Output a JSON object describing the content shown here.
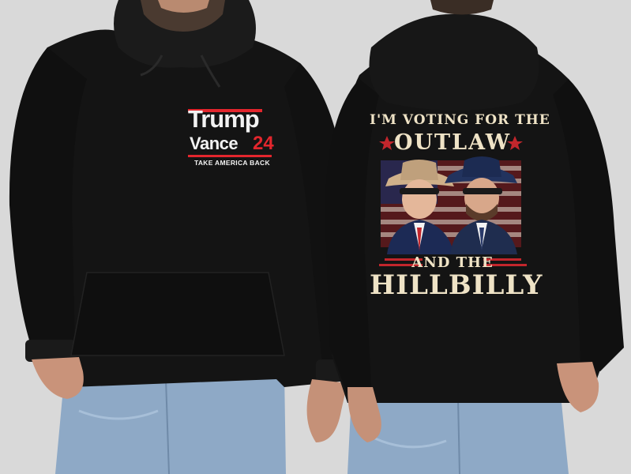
{
  "front": {
    "line1": "Trump",
    "line2": "Vance",
    "number": "24",
    "tagline": "TAKE AMERICA BACK"
  },
  "back": {
    "line1": "I'M VOTING FOR THE",
    "line2": "OUTLAW",
    "line3": "AND THE",
    "line4": "HILLBILLY"
  },
  "colors": {
    "background": "#d9d9d9",
    "hoodie": "#141414",
    "accent_red": "#e3262d",
    "print_cream": "#efe3c6",
    "jeans": "#8ea9c6"
  }
}
